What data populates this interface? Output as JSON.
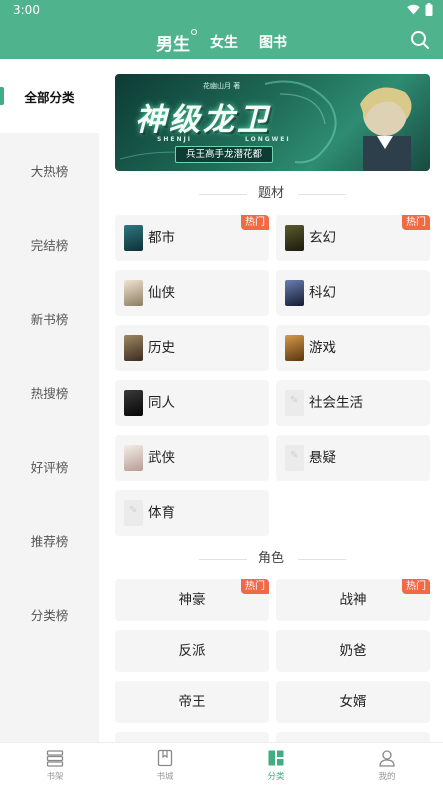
{
  "status_bar": {
    "time": "3:00"
  },
  "header": {
    "tabs": [
      {
        "label": "男生"
      },
      {
        "label": "女生"
      },
      {
        "label": "图书"
      }
    ],
    "accent_color": "#4fb38d"
  },
  "sidebar": {
    "items": [
      {
        "label": "全部分类",
        "active": true
      },
      {
        "label": "大热榜"
      },
      {
        "label": "完结榜"
      },
      {
        "label": "新书榜"
      },
      {
        "label": "热搜榜"
      },
      {
        "label": "好评榜"
      },
      {
        "label": "推荐榜"
      },
      {
        "label": "分类榜"
      }
    ]
  },
  "banner": {
    "title": "神级龙卫",
    "pinyin_left": "SHENJI",
    "pinyin_right": "LONGWEI",
    "author": "花幽山月 著",
    "slogan": "兵王高手龙潜花都"
  },
  "sections": {
    "themes_title": "题材",
    "roles_title": "角色",
    "hot_badge": "热门"
  },
  "themes": [
    {
      "label": "都市",
      "hot": true,
      "cover_color": "#1d4a52"
    },
    {
      "label": "玄幻",
      "hot": true,
      "cover_color": "#3b3a1c"
    },
    {
      "label": "仙侠",
      "hot": false,
      "cover_color": "#c9b79a"
    },
    {
      "label": "科幻",
      "hot": false,
      "cover_color": "#2b2f4a"
    },
    {
      "label": "历史",
      "hot": false,
      "cover_color": "#6a5640"
    },
    {
      "label": "游戏",
      "hot": false,
      "cover_color": "#8a5a2a"
    },
    {
      "label": "同人",
      "hot": false,
      "cover_color": "#1b1b1b"
    },
    {
      "label": "社会生活",
      "hot": false,
      "cover_color": ""
    },
    {
      "label": "武侠",
      "hot": false,
      "cover_color": "#d9c9c0"
    },
    {
      "label": "悬疑",
      "hot": false,
      "cover_color": ""
    },
    {
      "label": "体育",
      "hot": false,
      "cover_color": ""
    }
  ],
  "roles": [
    {
      "label": "神豪",
      "hot": true
    },
    {
      "label": "战神",
      "hot": true
    },
    {
      "label": "反派",
      "hot": false
    },
    {
      "label": "奶爸",
      "hot": false
    },
    {
      "label": "帝王",
      "hot": false
    },
    {
      "label": "女婿",
      "hot": false
    }
  ],
  "bottom_nav": [
    {
      "label": "书架",
      "icon": "bookshelf-icon"
    },
    {
      "label": "书城",
      "icon": "bookstore-icon"
    },
    {
      "label": "分类",
      "icon": "category-icon",
      "active": true
    },
    {
      "label": "我的",
      "icon": "profile-icon"
    }
  ]
}
